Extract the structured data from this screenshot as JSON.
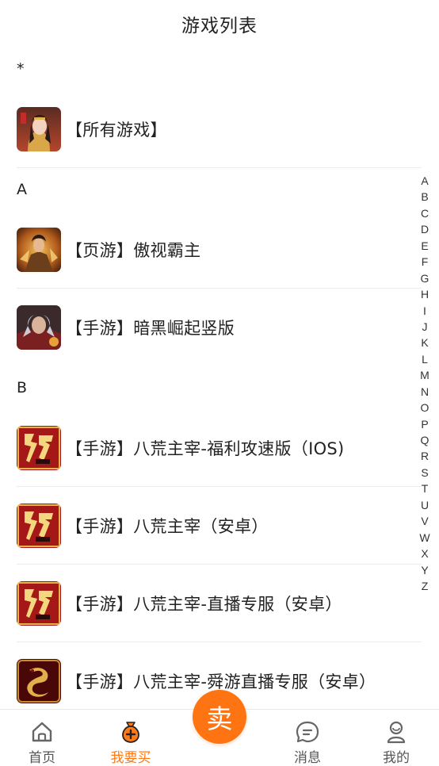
{
  "header": {
    "title": "游戏列表"
  },
  "sections": [
    {
      "key": "*",
      "items": [
        {
          "label": "【所有游戏】",
          "icon": "heroine-portrait-icon"
        }
      ]
    },
    {
      "key": "A",
      "items": [
        {
          "label": "【页游】傲视霸主",
          "icon": "warrior-fire-icon"
        },
        {
          "label": "【手游】暗黑崛起竖版",
          "icon": "silver-hair-warrior-icon"
        }
      ]
    },
    {
      "key": "B",
      "items": [
        {
          "label": "【手游】八荒主宰-福利攻速版（IOS)",
          "icon": "chuanshi-logo-icon"
        },
        {
          "label": "【手游】八荒主宰（安卓）",
          "icon": "chuanshi-logo-icon"
        },
        {
          "label": "【手游】八荒主宰-直播专服（安卓）",
          "icon": "chuanshi-logo-icon"
        },
        {
          "label": "【手游】八荒主宰-舜游直播专服（安卓）",
          "icon": "golden-dragon-icon"
        }
      ]
    }
  ],
  "index_letters": [
    "A",
    "B",
    "C",
    "D",
    "E",
    "F",
    "G",
    "H",
    "I",
    "J",
    "K",
    "L",
    "M",
    "N",
    "O",
    "P",
    "Q",
    "R",
    "S",
    "T",
    "U",
    "V",
    "W",
    "X",
    "Y",
    "Z"
  ],
  "tabbar": {
    "home": "首页",
    "buy": "我要买",
    "sell": "卖",
    "messages": "消息",
    "mine": "我的"
  },
  "colors": {
    "accent": "#ff7412",
    "text": "#222222",
    "divider": "#ececec"
  }
}
